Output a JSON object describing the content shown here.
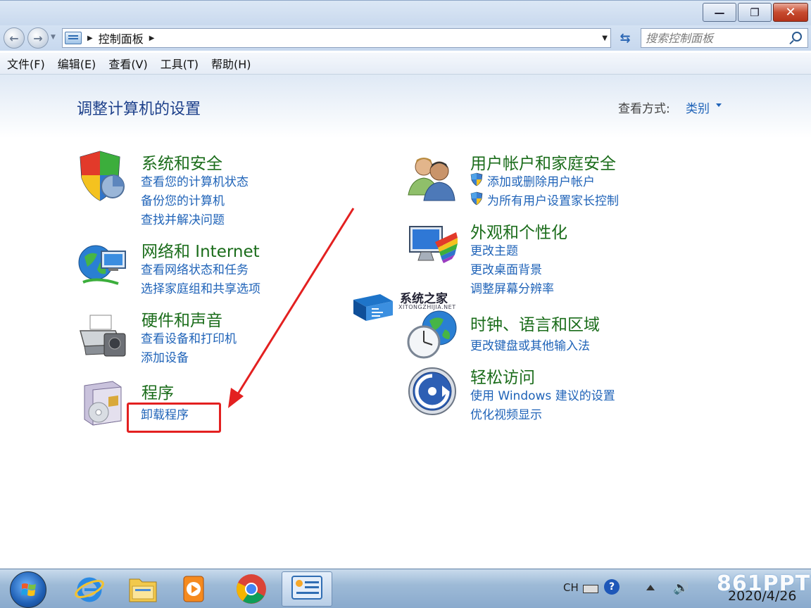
{
  "window": {
    "minimize_glyph": "—",
    "restore_glyph": "❐",
    "close_glyph": "✕"
  },
  "address": {
    "breadcrumb": "控制面板",
    "search_placeholder": "搜索控制面板"
  },
  "menu": [
    "文件(F)",
    "编辑(E)",
    "查看(V)",
    "工具(T)",
    "帮助(H)"
  ],
  "main": {
    "title": "调整计算机的设置",
    "view_by_label": "查看方式:",
    "view_by_value": "类别"
  },
  "categories": {
    "system_security": {
      "title": "系统和安全",
      "links": [
        "查看您的计算机状态",
        "备份您的计算机",
        "查找并解决问题"
      ],
      "icon": "shield-icon"
    },
    "network": {
      "title": "网络和 Internet",
      "links": [
        "查看网络状态和任务",
        "选择家庭组和共享选项"
      ],
      "icon": "network-globe-icon"
    },
    "hardware": {
      "title": "硬件和声音",
      "links": [
        "查看设备和打印机",
        "添加设备"
      ],
      "icon": "printer-icon"
    },
    "programs": {
      "title": "程序",
      "links": [
        "卸载程序"
      ],
      "icon": "programs-icon"
    },
    "user_accounts": {
      "title": "用户帐户和家庭安全",
      "links": [
        "添加或删除用户帐户",
        "为所有用户设置家长控制"
      ],
      "icon": "users-icon"
    },
    "appearance": {
      "title": "外观和个性化",
      "links": [
        "更改主题",
        "更改桌面背景",
        "调整屏幕分辨率"
      ],
      "icon": "monitor-palette-icon"
    },
    "clock_region": {
      "title": "时钟、语言和区域",
      "links": [
        "更改键盘或其他输入法"
      ],
      "icon": "clock-globe-icon"
    },
    "ease_of_access": {
      "title": "轻松访问",
      "links": [
        "使用 Windows 建议的设置",
        "优化视频显示"
      ],
      "icon": "ease-of-access-icon"
    }
  },
  "watermark": {
    "name": "系统之家",
    "domain": "XITONGZHIJIA.NET"
  },
  "taskbar": {
    "apps": [
      "internet-explorer-icon",
      "file-explorer-icon",
      "media-player-icon",
      "chrome-icon",
      "control-panel-icon"
    ],
    "input_lang": "CH",
    "help": "?",
    "date": "2020/4/26",
    "brand": "861PPT"
  },
  "colors": {
    "category_title": "#1a6c1a",
    "link": "#1f63b8",
    "page_title": "#1c3f8a",
    "annotation": "#e32020"
  }
}
